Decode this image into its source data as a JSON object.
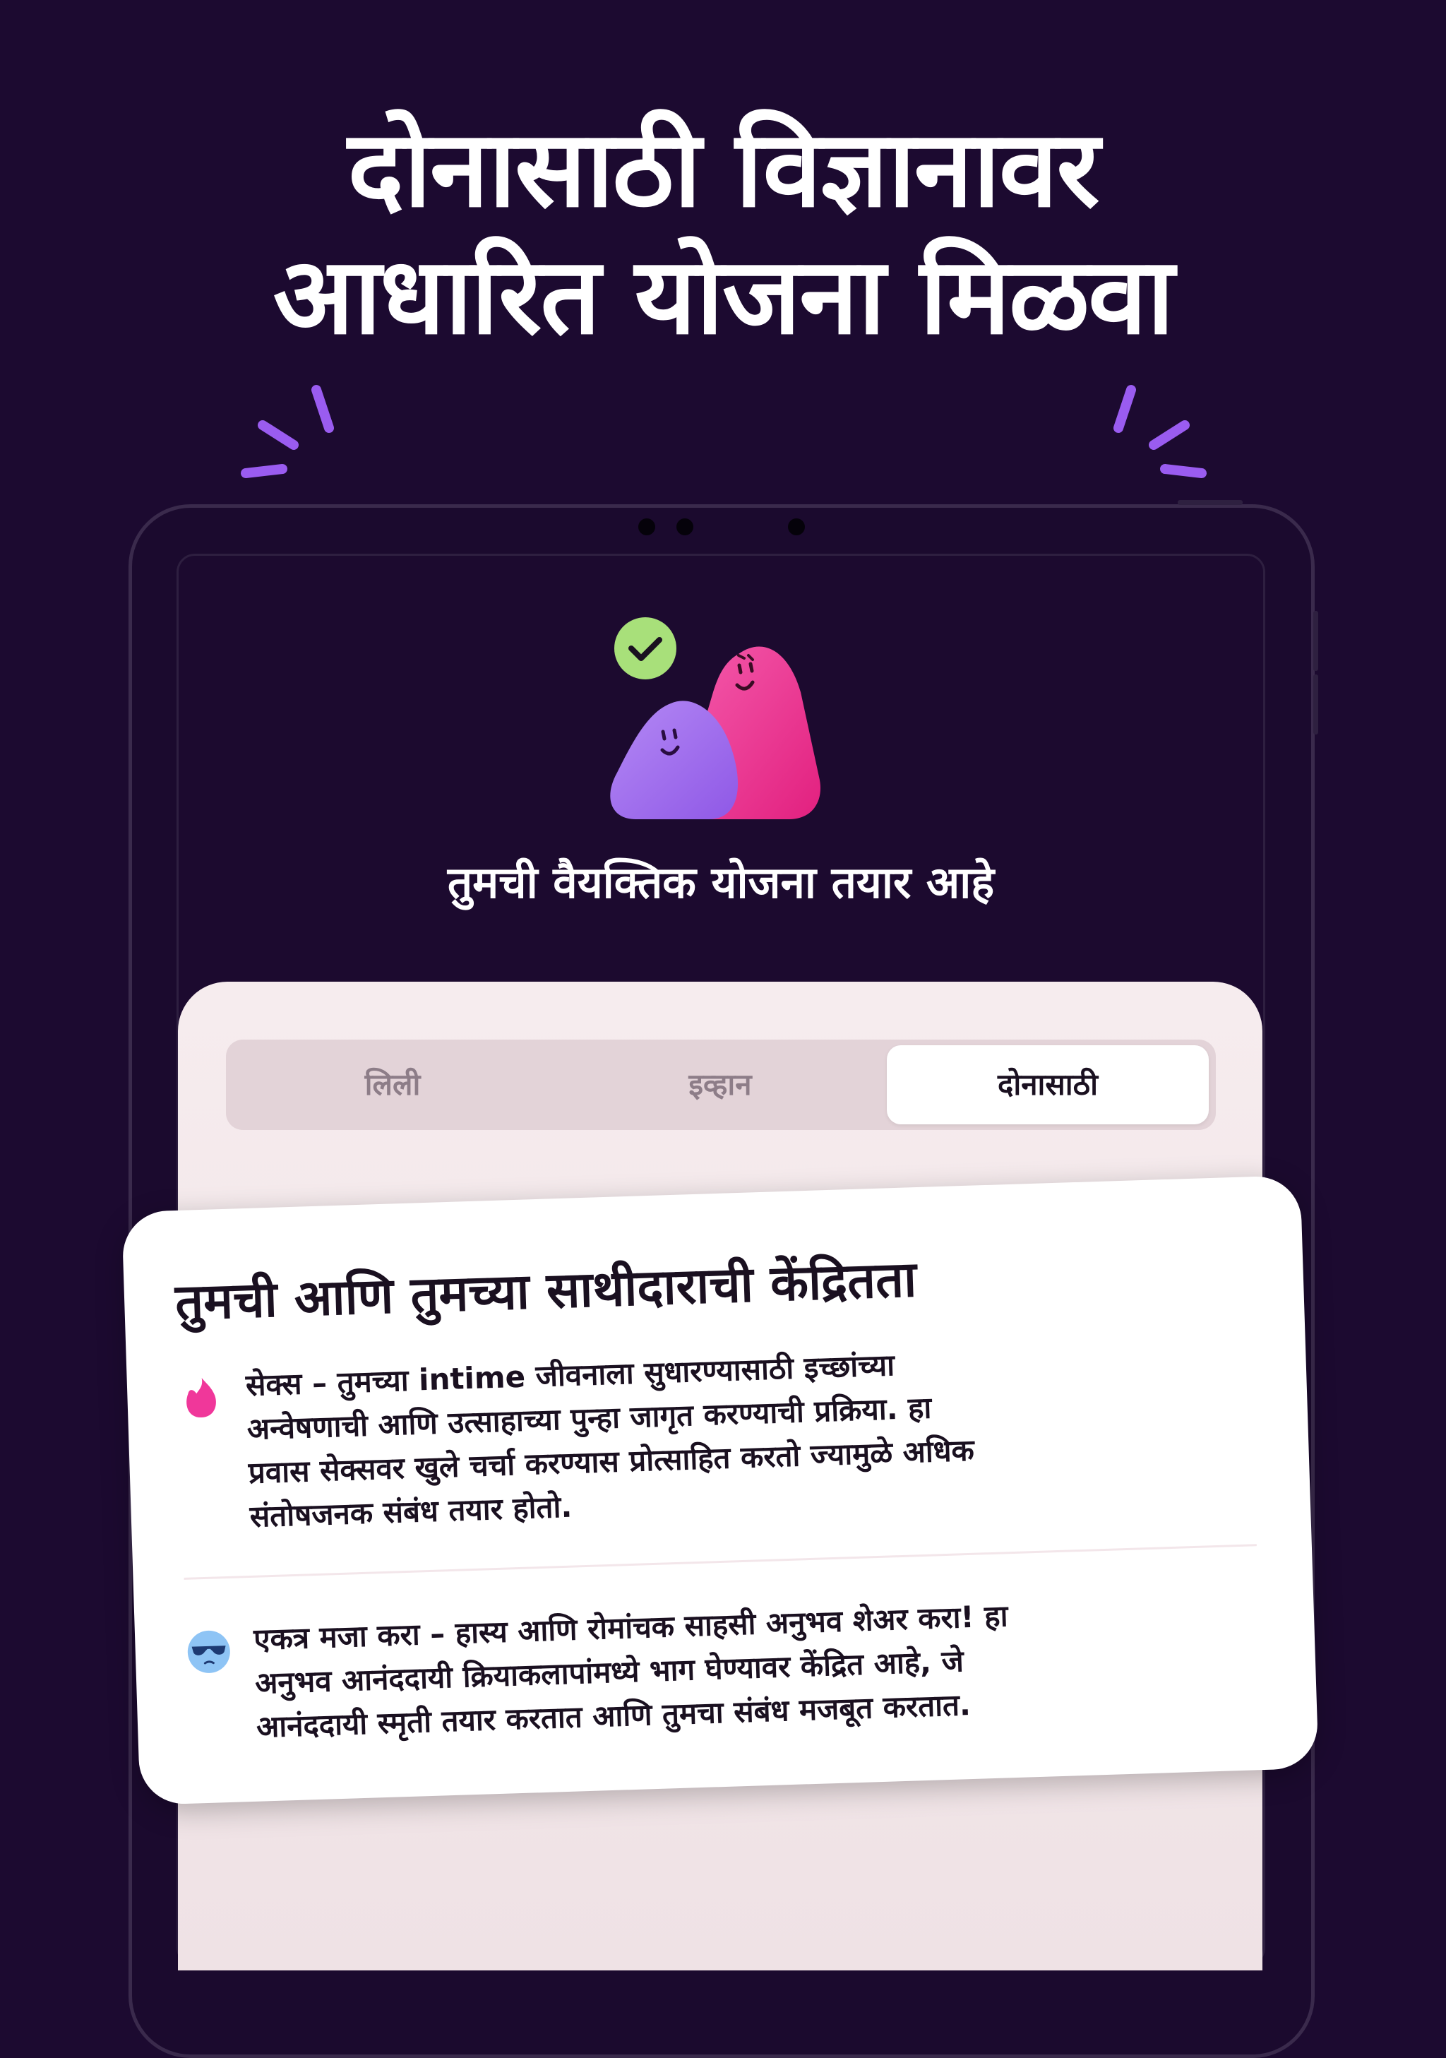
{
  "headline": {
    "line1": "दोनासाठी विज्ञानावर",
    "line2": "आधारित योजना मिळवा"
  },
  "screen": {
    "ready_title": "तुमची वैयक्तिक योजना तयार आहे",
    "tabs": [
      {
        "label": "लिली",
        "active": false
      },
      {
        "label": "इव्हान",
        "active": false
      },
      {
        "label": "दोनासाठी",
        "active": true
      }
    ]
  },
  "card": {
    "title": "तुमची आणि तुमच्या साथीदाराची केंद्रितता",
    "items": [
      {
        "icon": "flame-icon",
        "lines": [
          "सेक्स – तुमच्या intime जीवनाला सुधारण्यासाठी इच्छांच्या",
          "अन्वेषणाची आणि उत्साहाच्या पुन्हा जागृत करण्याची प्रक्रिया. हा",
          "प्रवास सेक्सवर खुले चर्चा करण्यास प्रोत्साहित करतो ज्यामुळे अधिक",
          "संतोषजनक संबंध तयार होतो."
        ]
      },
      {
        "icon": "cool-face-icon",
        "lines": [
          "एकत्र मजा करा – हास्य आणि रोमांचक साहसी अनुभव शेअर करा! हा",
          "अनुभव आनंददायी क्रियाकलापांमध्ये भाग घेण्यावर केंद्रित आहे, जे",
          "आनंददायी स्मृती तयार करतात आणि तुमचा संबंध मजबूत करतात."
        ]
      }
    ]
  },
  "colors": {
    "background": "#1c0a30",
    "accent_purple": "#a66cf0",
    "accent_pink": "#f0379a",
    "check_green": "#a8e07a",
    "card_bg": "#ffffff",
    "sheet_bg": "#f6ecee"
  }
}
